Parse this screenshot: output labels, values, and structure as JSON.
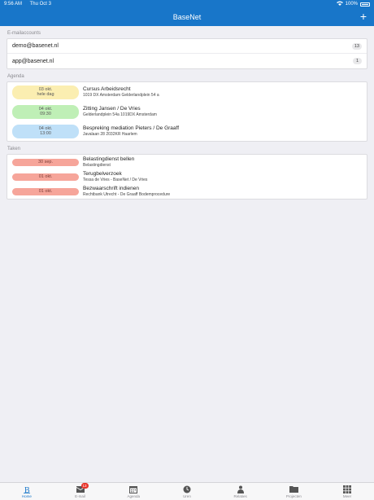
{
  "status": {
    "time": "9:56 AM",
    "date": "Thu Oct 3",
    "battery": "100%"
  },
  "header": {
    "title": "BaseNet",
    "add_label": "+"
  },
  "accounts": {
    "label": "E-mailaccounts",
    "items": [
      {
        "email": "demo@basenet.nl",
        "count": "13"
      },
      {
        "email": "app@basenet.nl",
        "count": "1"
      }
    ]
  },
  "agenda": {
    "label": "Agenda",
    "items": [
      {
        "date": "03 okt.",
        "time": "hele dag",
        "title": "Cursus Arbeidsrecht",
        "subtitle": "1019 DX  Amsterdam Gelderlandplein 54 a",
        "color": "#fbeeb1"
      },
      {
        "date": "04 okt.",
        "time": "09:30",
        "title": "Zitting Jansen / De Vries",
        "subtitle": "Gelderlandplein 54a 1019DX  Amsterdam",
        "color": "#bfefb6"
      },
      {
        "date": "04 okt.",
        "time": "13:00",
        "title": "Bespreking mediation Pieters / De Graaff",
        "subtitle": "Javalaan 28 2032KR Haarlem",
        "color": "#bfe0f8"
      }
    ]
  },
  "tasks": {
    "label": "Taken",
    "items": [
      {
        "date": "30 sep.",
        "title": "Belastingdienst bellen",
        "subtitle": "Belastingdienst",
        "color": "#f6a59a"
      },
      {
        "date": "01 okt.",
        "title": "Terugbelverzoek",
        "subtitle": "Tessa de Vries - BaseNet / De Vries",
        "color": "#f6a59a"
      },
      {
        "date": "01 okt.",
        "title": "Bezwaarschrift indienen",
        "subtitle": "Rechtbank Utrecht - De Graaff Bodemprocedure",
        "color": "#f6a59a"
      }
    ]
  },
  "tabbar": {
    "tabs": [
      {
        "label": "Home",
        "icon": "basenet-b-icon"
      },
      {
        "label": "E-mail",
        "icon": "mail-icon",
        "badge": "13"
      },
      {
        "label": "Agenda",
        "icon": "calendar-icon"
      },
      {
        "label": "Uren",
        "icon": "clock-icon"
      },
      {
        "label": "Relaties",
        "icon": "people-icon"
      },
      {
        "label": "Projecten",
        "icon": "folder-icon"
      },
      {
        "label": "Meer",
        "icon": "grid-icon"
      }
    ],
    "active_color": "#1876c9"
  }
}
